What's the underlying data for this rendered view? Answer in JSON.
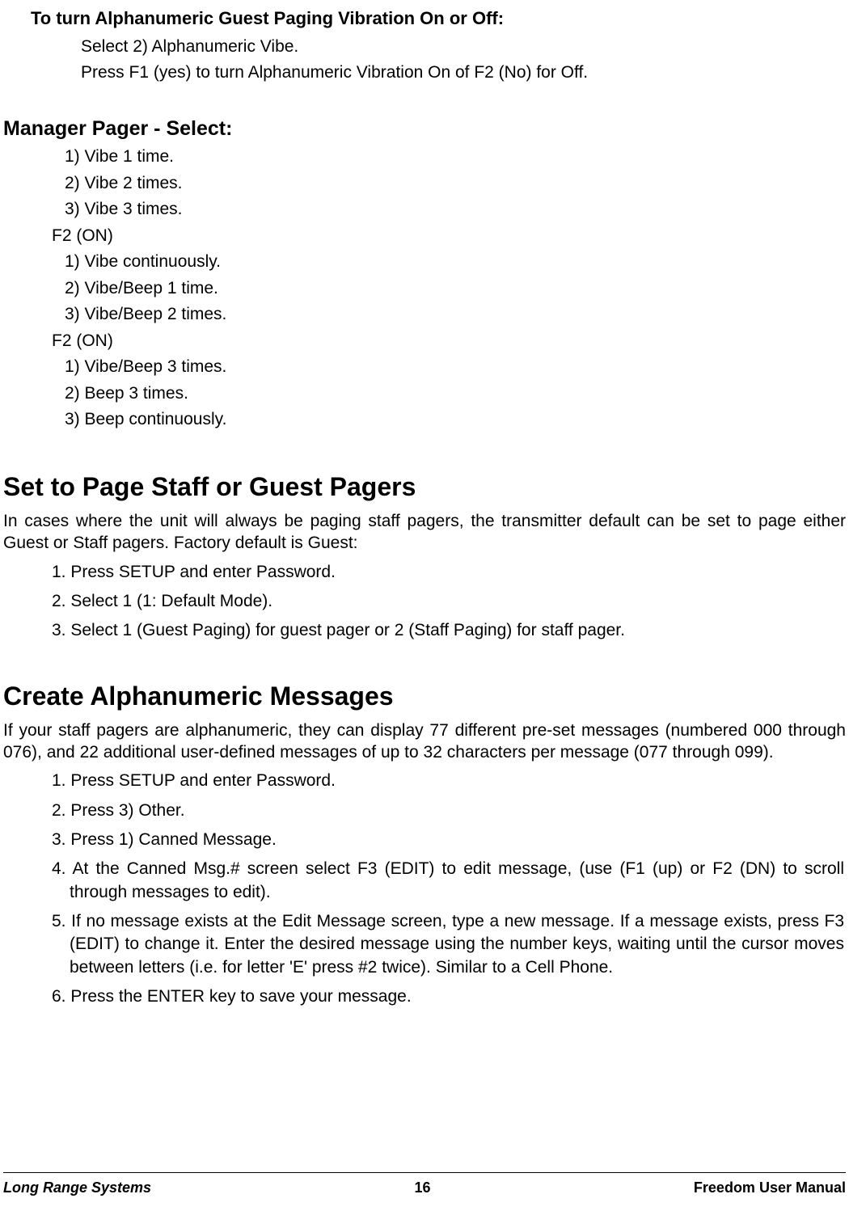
{
  "section_alpha_vibe": {
    "heading": "To turn Alphanumeric Guest Paging Vibration On or Off:",
    "line1": "Select 2) Alphanumeric Vibe.",
    "line2": "Press F1 (yes) to turn Alphanumeric Vibration On of F2 (No) for Off."
  },
  "section_manager_pager": {
    "heading": "Manager Pager - Select:",
    "group1": {
      "item1": "1) Vibe 1 time.",
      "item2": "2) Vibe 2 times.",
      "item3": "3) Vibe 3 times."
    },
    "f2_1": "F2 (ON)",
    "group2": {
      "item1": "1) Vibe continuously.",
      "item2": "2) Vibe/Beep 1 time.",
      "item3": "3) Vibe/Beep 2 times."
    },
    "f2_2": "F2 (ON)",
    "group3": {
      "item1": "1) Vibe/Beep 3 times.",
      "item2": "2) Beep 3 times.",
      "item3": "3) Beep continuously."
    }
  },
  "section_set_page": {
    "heading": "Set to Page Staff or Guest Pagers",
    "intro": "In cases where the unit will always be paging staff pagers, the transmitter default can be set to page either Guest or Staff pagers.  Factory default is Guest:",
    "steps": {
      "s1": "1. Press SETUP and enter Password.",
      "s2": "2. Select 1 (1: Default Mode).",
      "s3": "3. Select 1 (Guest Paging) for guest pager or 2 (Staff Paging) for staff pager."
    }
  },
  "section_create_alpha": {
    "heading": "Create Alphanumeric Messages",
    "intro": "If your staff pagers are alphanumeric, they can display 77 different pre-set messages (numbered 000 through 076), and 22 additional user-defined messages of up to 32 characters per message (077 through 099).",
    "steps": {
      "s1": "1. Press SETUP and enter Password.",
      "s2": "2. Press 3) Other.",
      "s3": "3. Press 1) Canned Message.",
      "s4": "4. At the Canned Msg.# screen select F3 (EDIT) to edit message, (use (F1 (up) or F2 (DN) to scroll through messages to edit).",
      "s5": "5. If no message exists at the Edit Message screen, type a new message. If a message exists, press F3 (EDIT) to change it. Enter the desired message using the number keys, waiting until the cursor moves between letters (i.e. for letter 'E' press #2 twice). Similar to a Cell Phone.",
      "s6": "6. Press the ENTER key to save your message."
    }
  },
  "footer": {
    "left": "Long Range Systems",
    "center": "16",
    "right": "Freedom User Manual"
  }
}
